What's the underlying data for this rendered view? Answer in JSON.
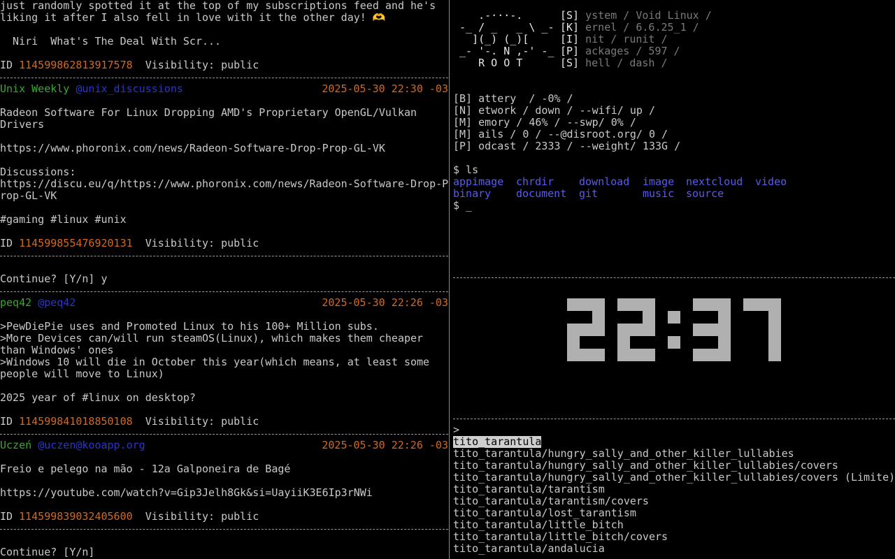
{
  "feed": {
    "intro": [
      "just randomly spotted it at the top of my subscriptions feed and he's",
      "liking it after I also fell in love with it the other day! 🫶",
      "",
      "  Niri  What's The Deal With Scr...",
      ""
    ],
    "intro_id": "114599862813917578",
    "id_label": "ID",
    "visibility_label": "Visibility: public",
    "posts": [
      {
        "name": "Unix Weekly",
        "handle": "@unix_discussions",
        "date": "2025-05-30 22:30 -03",
        "lines": [
          "",
          "Radeon Software For Linux Dropping AMD's Proprietary OpenGL/Vulkan",
          "Drivers",
          "",
          "https://www.phoronix.com/news/Radeon-Software-Drop-Prop-GL-VK",
          "",
          "Discussions:",
          "https://discu.eu/q/https://www.phoronix.com/news/Radeon-Software-Drop-P",
          "rop-GL-VK",
          "",
          "#gaming #linux #unix",
          ""
        ],
        "id": "114599855476920131"
      },
      {
        "name": "peq42",
        "handle": "@peq42",
        "date": "2025-05-30 22:26 -03",
        "lines": [
          "",
          ">PewDiePie uses and Promoted Linux to his 100+ Million subs.",
          ">More Devices can/will run steamOS(Linux), which makes them cheaper",
          "than Windows' ones",
          ">Windows 10 will die in October this year(which means, at least some",
          "people will move to Linux)",
          "",
          "2025 year of #linux on desktop?",
          ""
        ],
        "id": "114599841018850108"
      },
      {
        "name": "Uczeń",
        "handle": "@uczen@kooapp.org",
        "date": "2025-05-30 22:26 -03",
        "lines": [
          "",
          "Freio e pelego na mão - 12a Galponeira de Bagé",
          "",
          "https://youtube.com/watch?v=Gip3Jelh8Gk&si=UayiiK3E6Ip3rNWi",
          ""
        ],
        "id": "114599839032405600"
      }
    ],
    "continue_1": "Continue? [Y/n] y",
    "continue_2": "Continue? [Y/n]"
  },
  "fetch": {
    "logo": [
      "    .-···-.",
      " -_ / _   _ \\ _-",
      "   ](_) (_)[",
      " _- '-. N ,-' -_",
      "    R O O T"
    ],
    "info": [
      {
        "key": "[S]",
        "val": "ystem / Void Linux /"
      },
      {
        "key": "[K]",
        "val": "ernel / 6.6.25_1 /"
      },
      {
        "key": "[I]",
        "val": "nit / runit /"
      },
      {
        "key": "[P]",
        "val": "ackages / 597 /"
      },
      {
        "key": "[S]",
        "val": "hell / dash /"
      }
    ],
    "stats": [
      "[B] attery  / -0% /",
      "[N] etwork / down / --wifi/ up /",
      "[M] emory / 46% / --swp/ 0% /",
      "[M] ails / 0 / --@disroot.org/ 0 /",
      "[P] odcast / 2333 / --weight/ 133G /"
    ]
  },
  "shell": {
    "cmd": "$ ls",
    "ls_row1": [
      "appimage",
      "chrdir",
      "download",
      "image",
      "nextcloud",
      "video"
    ],
    "ls_row2": [
      "binary",
      "document",
      "git",
      "music",
      "source"
    ],
    "prompt": "$ _"
  },
  "clock": {
    "time": "22:37"
  },
  "fzf": {
    "prompt": ">",
    "selected": "tito_tarantula",
    "items": [
      "tito_tarantula/hungry_sally_and_other_killer_lullabies",
      "tito_tarantula/hungry_sally_and_other_killer_lullabies/covers",
      "tito_tarantula/hungry_sally_and_other_killer_lullabies/covers (Limite)",
      "tito_tarantula/tarantism",
      "tito_tarantula/tarantism/covers",
      "tito_tarantula/lost_tarantism",
      "tito_tarantula/little_bitch",
      "tito_tarantula/little_bitch/covers",
      "tito_tarantula/andalucia"
    ]
  },
  "colors": {
    "name": "#3aa831",
    "handle": "#2a35c9",
    "date_id": "#d4691c",
    "ls_dir": "#5a5af0",
    "clock": "#b0b0b0"
  }
}
